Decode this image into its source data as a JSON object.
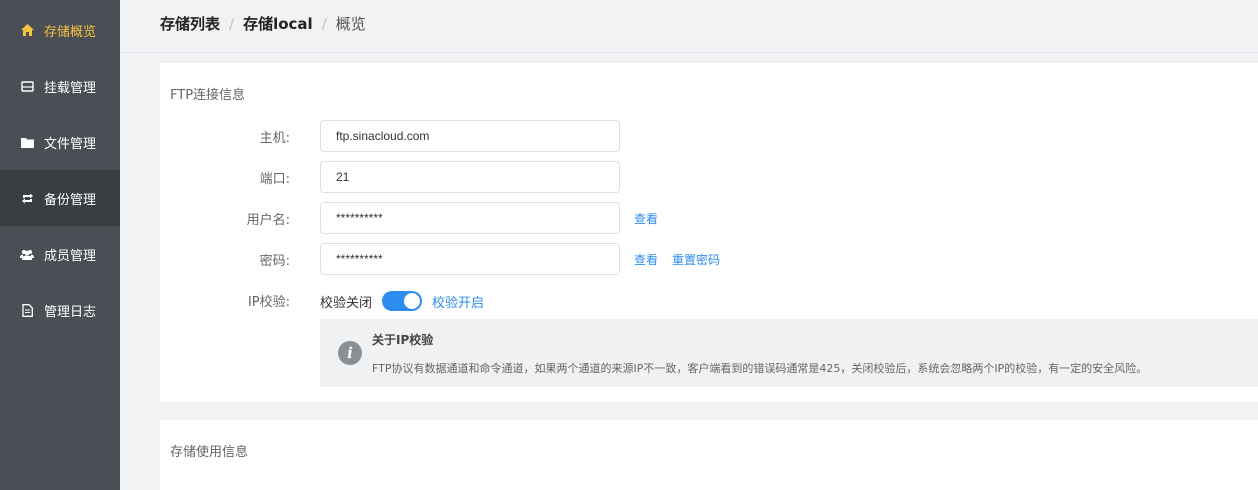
{
  "sidebar": {
    "items": [
      {
        "label": "存储概览",
        "icon": "home-icon"
      },
      {
        "label": "挂载管理",
        "icon": "hard-drive-icon"
      },
      {
        "label": "文件管理",
        "icon": "folder-icon"
      },
      {
        "label": "备份管理",
        "icon": "refresh-icon"
      },
      {
        "label": "成员管理",
        "icon": "users-icon"
      },
      {
        "label": "管理日志",
        "icon": "document-icon"
      }
    ],
    "accent_color": "#f5c242"
  },
  "breadcrumb": {
    "items": [
      "存储列表",
      "存储local"
    ],
    "separator": "/",
    "current": "概览"
  },
  "ftp": {
    "title": "FTP连接信息",
    "host_label": "主机:",
    "host_value": "ftp.sinacloud.com",
    "port_label": "端口:",
    "port_value": "21",
    "username_label": "用户名:",
    "username_value": "**********",
    "username_view": "查看",
    "password_label": "密码:",
    "password_value": "**********",
    "password_view": "查看",
    "password_reset": "重置密码",
    "ip_label": "IP校验:",
    "ip_off_label": "校验关闭",
    "ip_on_label": "校验开启",
    "ip_enabled": true,
    "notice_title": "关于IP校验",
    "notice_text": "FTP协议有数据通道和命令通道，如果两个通道的来源IP不一致，客户端看到的错误码通常是425，关闭校验后，系统会忽略两个IP的校验，有一定的安全风险。"
  },
  "usage": {
    "title": "存储使用信息"
  },
  "colors": {
    "link": "#2d8cf0",
    "sidebar_bg": "#4a4f55"
  }
}
